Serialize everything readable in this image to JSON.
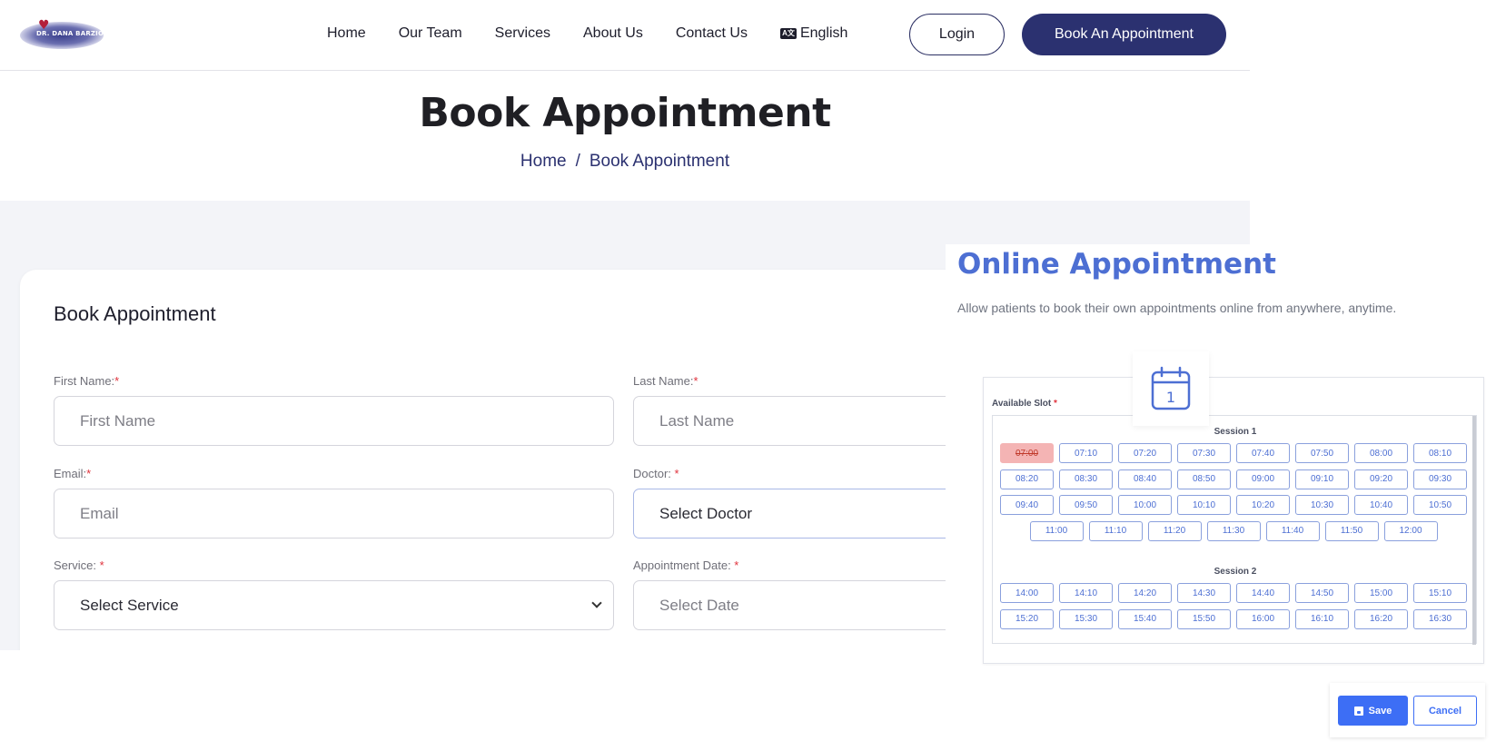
{
  "header": {
    "logo_text": "DR. DANA BARZIO",
    "nav": [
      "Home",
      "Our Team",
      "Services",
      "About Us",
      "Contact Us"
    ],
    "language": "English",
    "login_label": "Login",
    "book_label": "Book An Appointment"
  },
  "hero": {
    "title": "Book Appointment",
    "breadcrumb_home": "Home",
    "breadcrumb_sep": "/",
    "breadcrumb_current": "Book Appointment"
  },
  "form": {
    "title": "Book Appointment",
    "first_name_label": "First Name:",
    "first_name_placeholder": "First Name",
    "last_name_label": "Last Name:",
    "last_name_placeholder": "Last Name",
    "email_label": "Email:",
    "email_placeholder": "Email",
    "doctor_label": "Doctor: ",
    "doctor_value": "Select Doctor",
    "service_label": "Service: ",
    "service_value": "Select Service",
    "date_label": "Appointment Date: ",
    "date_placeholder": "Select Date",
    "required_mark": "*"
  },
  "overlay": {
    "title": "Online Appointment",
    "subtitle": "Allow patients to book their own appointments online from anywhere, anytime.",
    "calendar_day": "1",
    "available_slot_label": "Available Slot",
    "session1_title": "Session 1",
    "session2_title": "Session 2",
    "session1_rows": [
      [
        "07:00",
        "07:10",
        "07:20",
        "07:30",
        "07:40",
        "07:50",
        "08:00",
        "08:10"
      ],
      [
        "08:20",
        "08:30",
        "08:40",
        "08:50",
        "09:00",
        "09:10",
        "09:20",
        "09:30"
      ],
      [
        "09:40",
        "09:50",
        "10:00",
        "10:10",
        "10:20",
        "10:30",
        "10:40",
        "10:50"
      ],
      [
        "11:00",
        "11:10",
        "11:20",
        "11:30",
        "11:40",
        "11:50",
        "12:00"
      ]
    ],
    "session2_rows": [
      [
        "14:00",
        "14:10",
        "14:20",
        "14:30",
        "14:40",
        "14:50",
        "15:00",
        "15:10"
      ],
      [
        "15:20",
        "15:30",
        "15:40",
        "15:50",
        "16:00",
        "16:10",
        "16:20",
        "16:30"
      ]
    ],
    "booked_slot": "07:00",
    "save_label": "Save",
    "cancel_label": "Cancel"
  },
  "colors": {
    "brand_navy": "#2b3170",
    "overlay_accent": "#4d6fd3",
    "save_blue": "#3d6ef5",
    "booked_red": "#f4b4b4"
  }
}
